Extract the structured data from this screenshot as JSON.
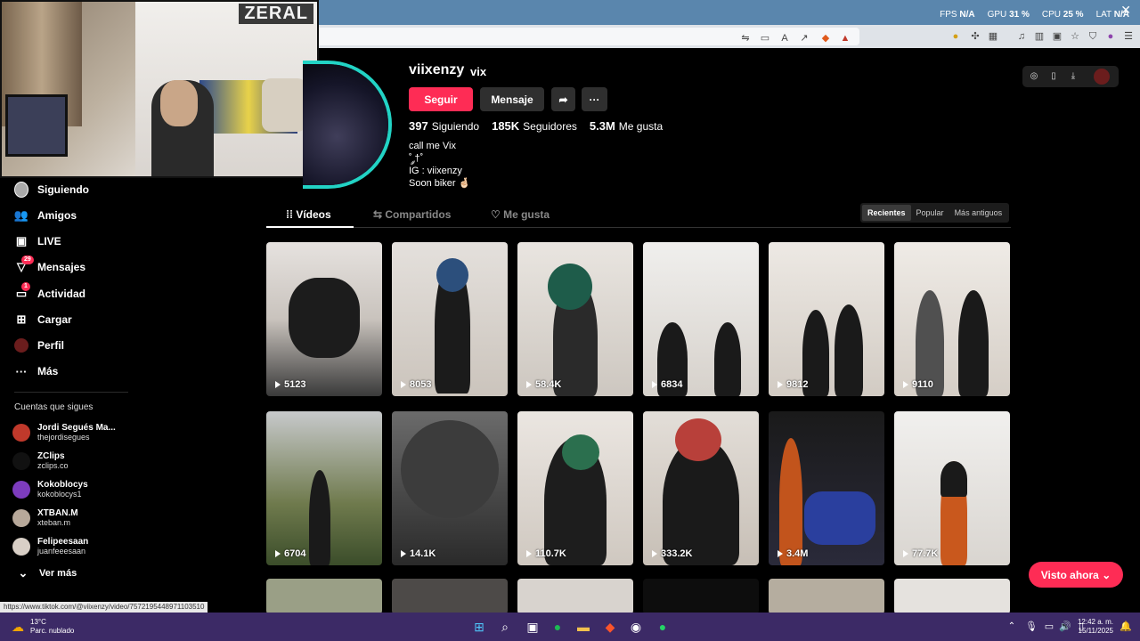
{
  "stats": {
    "fps_label": "FPS",
    "fps_value": "N/A",
    "gpu_label": "GPU",
    "gpu_value": "31 %",
    "cpu_label": "CPU",
    "cpu_value": "25 %",
    "lat_label": "LAT",
    "lat_value": "N/A"
  },
  "stream_overlay": {
    "brand": "ZERAL"
  },
  "sidebar": {
    "items": [
      {
        "label": "Siguiendo",
        "icon": "following-avatar-icon"
      },
      {
        "label": "Amigos",
        "icon": "friends-icon"
      },
      {
        "label": "LIVE",
        "icon": "live-icon"
      },
      {
        "label": "Mensajes",
        "icon": "messages-icon",
        "badge": "29"
      },
      {
        "label": "Actividad",
        "icon": "activity-icon",
        "badge": "1"
      },
      {
        "label": "Cargar",
        "icon": "upload-icon"
      },
      {
        "label": "Perfil",
        "icon": "profile-avatar-icon"
      },
      {
        "label": "Más",
        "icon": "more-icon"
      }
    ],
    "section_label": "Cuentas que sigues",
    "accounts": [
      {
        "name": "Jordi Segués Ma...",
        "handle": "thejordisegues"
      },
      {
        "name": "ZClips",
        "handle": "zclips.co"
      },
      {
        "name": "Kokoblocys",
        "handle": "kokoblocys1"
      },
      {
        "name": "XTBAN.M",
        "handle": "xteban.m"
      },
      {
        "name": "Felipeesaan",
        "handle": "juanfeeesaan"
      }
    ],
    "see_more": "Ver más"
  },
  "profile": {
    "username": "viixenzy",
    "nickname": "vix",
    "follow_label": "Seguir",
    "message_label": "Mensaje",
    "following_count": "397",
    "following_label": "Siguiendo",
    "followers_count": "185K",
    "followers_label": "Seguidores",
    "likes_count": "5.3M",
    "likes_label": "Me gusta",
    "bio": [
      "call me Vix",
      "˚ ༘†˚",
      "IG : viixenzy",
      "Soon biker 🤞🏻"
    ]
  },
  "tabs": {
    "videos": "Vídeos",
    "reposts": "Compartidos",
    "liked": "Me gusta"
  },
  "sort": {
    "recent": "Recientes",
    "popular": "Popular",
    "oldest": "Más antiguos"
  },
  "videos": [
    "5123",
    "8053",
    "58.4K",
    "6834",
    "9812",
    "9110",
    "6704",
    "14.1K",
    "110.7K",
    "333.2K",
    "3.4M",
    "77.7K"
  ],
  "visto_ahora": "Visto ahora",
  "status_url": "https://www.tiktok.com/@viixenzy/video/7572195448971103510",
  "taskbar": {
    "temp": "13°C",
    "weather": "Parc. nublado",
    "time": "12:42 a. m.",
    "date": "15/11/2025"
  }
}
